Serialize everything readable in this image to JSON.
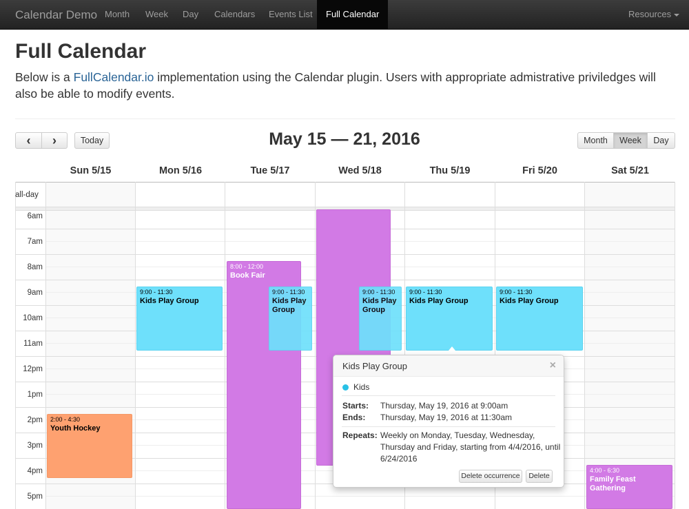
{
  "navbar": {
    "brand": "Calendar Demo",
    "items": [
      {
        "label": "Month",
        "active": false
      },
      {
        "label": "Week",
        "active": false
      },
      {
        "label": "Day",
        "active": false
      },
      {
        "label": "Calendars",
        "active": false
      },
      {
        "label": "Events List",
        "active": false
      },
      {
        "label": "Full Calendar",
        "active": true
      }
    ],
    "resources": "Resources"
  },
  "page": {
    "title": "Full Calendar",
    "lead_prefix": "Below is a ",
    "lead_link": "FullCalendar.io",
    "lead_suffix": " implementation using the Calendar plugin. Users with appropriate admistrative priviledges will also be able to modify events."
  },
  "toolbar": {
    "prev": "‹",
    "next": "›",
    "today": "Today",
    "title": "May 15 — 21, 2016",
    "views": [
      "Month",
      "Week",
      "Day"
    ],
    "active_view": "Week"
  },
  "calendar": {
    "days": [
      "Sun 5/15",
      "Mon 5/16",
      "Tue 5/17",
      "Wed 5/18",
      "Thu 5/19",
      "Fri 5/20",
      "Sat 5/21"
    ],
    "allday_label": "all-day",
    "times": [
      "6am",
      "7am",
      "8am",
      "9am",
      "10am",
      "11am",
      "12pm",
      "1pm",
      "2pm",
      "3pm",
      "4pm",
      "5pm"
    ],
    "events": [
      {
        "time": "9:00 - 11:30",
        "title": "Kids Play Group",
        "color": "#6ee0fb"
      },
      {
        "time": "8:00 - 12:00",
        "title": "Book Fair",
        "color": "#d27ae5"
      },
      {
        "time": "9:00 - 11:30",
        "title": "Kids Play Group",
        "color": "#6ee0fb"
      },
      {
        "time": "9:00 - 11:30",
        "title": "Kids Play Group",
        "color": "#6ee0fb"
      },
      {
        "time": "9:00 - 11:30",
        "title": "Kids Play Group",
        "color": "#6ee0fb"
      },
      {
        "time": "9:00 - 11:30",
        "title": "Kids Play Group",
        "color": "#6ee0fb"
      },
      {
        "time": "2:00 - 4:30",
        "title": "Youth Hockey",
        "color": "#fea170"
      },
      {
        "time": "4:00 - 6:30",
        "title": "Family Feast Gathering",
        "color": "#d27ae5"
      }
    ]
  },
  "popover": {
    "title": "Kids Play Group",
    "close": "×",
    "calendar_name": "Kids",
    "calendar_color": "#29c1e6",
    "starts_label": "Starts:",
    "starts_value": "Thursday, May 19, 2016 at 9:00am",
    "ends_label": "Ends:",
    "ends_value": "Thursday, May 19, 2016 at 11:30am",
    "repeats_label": "Repeats:",
    "repeats_value": "Weekly on Monday, Tuesday, Wednesday, Thursday and Friday, starting from 4/4/2016, until 6/24/2016",
    "delete_occurrence": "Delete occurrence",
    "delete": "Delete"
  }
}
